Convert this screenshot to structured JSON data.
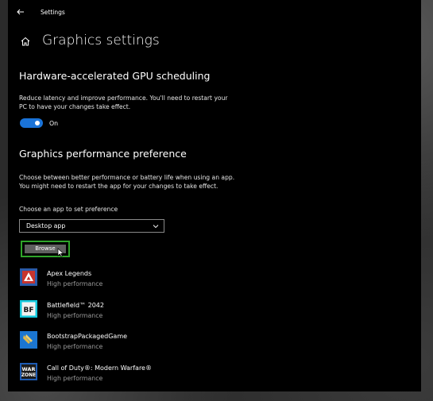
{
  "titlebar": {
    "title": "Settings",
    "back_icon": "back-arrow-icon"
  },
  "page": {
    "title": "Graphics settings",
    "home_icon": "home-icon"
  },
  "gpu_scheduling": {
    "heading": "Hardware-accelerated GPU scheduling",
    "description_line1": "Reduce latency and improve performance. You'll need to restart your",
    "description_line2": "PC to have your changes take effect.",
    "toggle_state": "On",
    "toggle_on": true,
    "accent_color": "#1a73d8"
  },
  "performance_pref": {
    "heading": "Graphics performance preference",
    "description_line1": "Choose between better performance or battery life when using an app.",
    "description_line2": "You might need to restart the app for your changes to take effect.",
    "choose_label": "Choose an app to set preference",
    "dropdown_value": "Desktop app",
    "browse_label": "Browse",
    "highlight_color": "#2fa52a"
  },
  "apps": [
    {
      "name": "Apex Legends",
      "preference": "High performance",
      "icon": "apex-legends-icon"
    },
    {
      "name": "Battlefield™ 2042",
      "preference": "High performance",
      "icon": "battlefield-icon",
      "icon_text": "BF"
    },
    {
      "name": "BootstrapPackagedGame",
      "preference": "High performance",
      "icon": "bootstrap-game-icon"
    },
    {
      "name": "Call of Duty®: Modern Warfare®",
      "preference": "High performance",
      "icon": "warzone-icon",
      "icon_text_1": "WAR",
      "icon_text_2": "ZONE"
    }
  ]
}
